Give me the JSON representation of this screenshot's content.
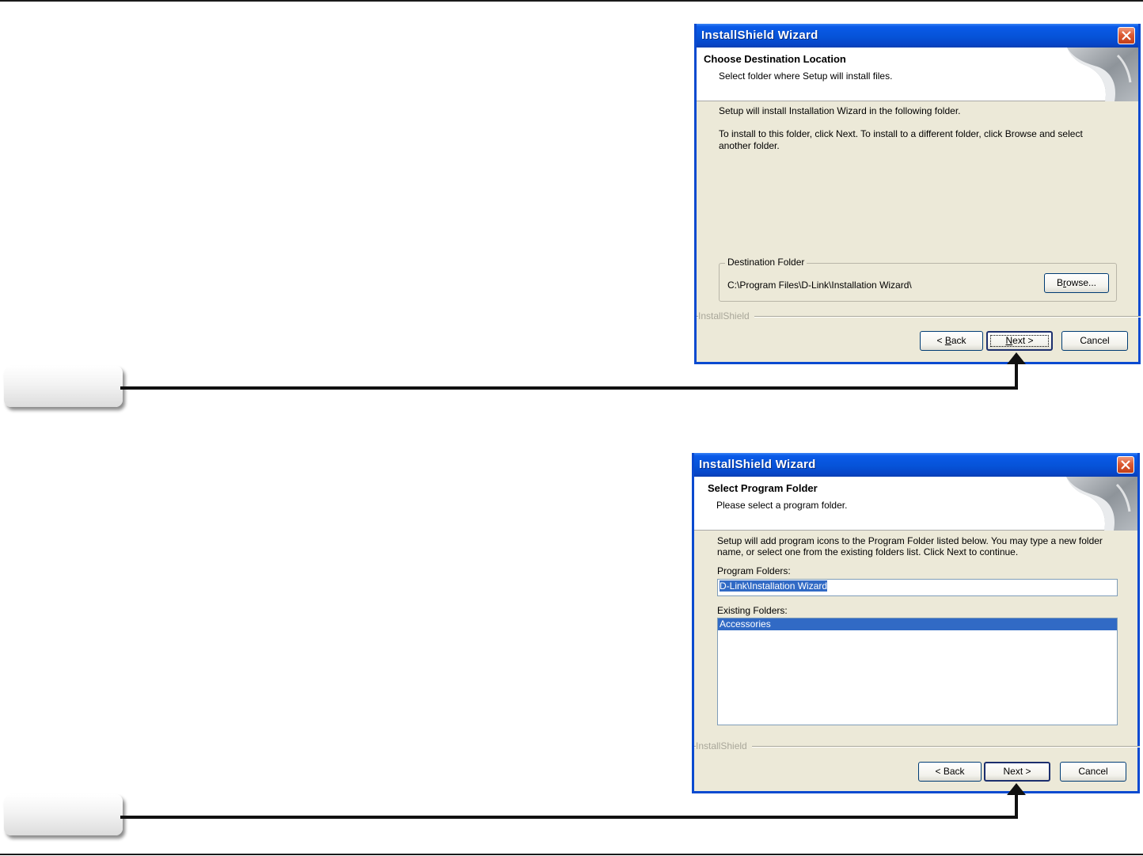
{
  "dialog1": {
    "title": "InstallShield Wizard",
    "header_title": "Choose Destination Location",
    "header_subtitle": "Select folder where Setup will install files.",
    "line1": "Setup will install Installation Wizard in the following folder.",
    "line2": "To install to this folder, click Next. To install to a different folder, click Browse and select",
    "line3": "another folder.",
    "group_label": "Destination Folder",
    "folder_path": "C:\\Program Files\\D-Link\\Installation Wizard\\",
    "browse_pre": "B",
    "browse_mn": "r",
    "browse_post": "owse...",
    "brand": "InstallShield",
    "back_pre": "< ",
    "back_mn": "B",
    "back_post": "ack",
    "next_mn": "N",
    "next_post": "ext >",
    "cancel_label": "Cancel"
  },
  "dialog2": {
    "title": "InstallShield Wizard",
    "header_title": "Select Program Folder",
    "header_subtitle": "Please select a program folder.",
    "line1": "Setup will add program icons to the Program Folder listed below.  You may type a new folder",
    "line2": "name, or select one from the existing folders list.  Click Next to continue.",
    "program_folders_label": "Program Folders:",
    "program_folder_value": "D-Link\\Installation Wizard",
    "existing_folders_label": "Existing Folders:",
    "existing_folders": [
      "Accessories"
    ],
    "brand": "InstallShield",
    "back_label": "< Back",
    "next_label": "Next >",
    "cancel_label": "Cancel"
  },
  "colors": {
    "titlebar": "#0653d8",
    "dialog_face": "#ece9d8",
    "selection": "#316ac5",
    "close_button": "#dc5a33"
  },
  "icons": [
    "close-icon",
    "wizard-page-curl-graphic"
  ]
}
